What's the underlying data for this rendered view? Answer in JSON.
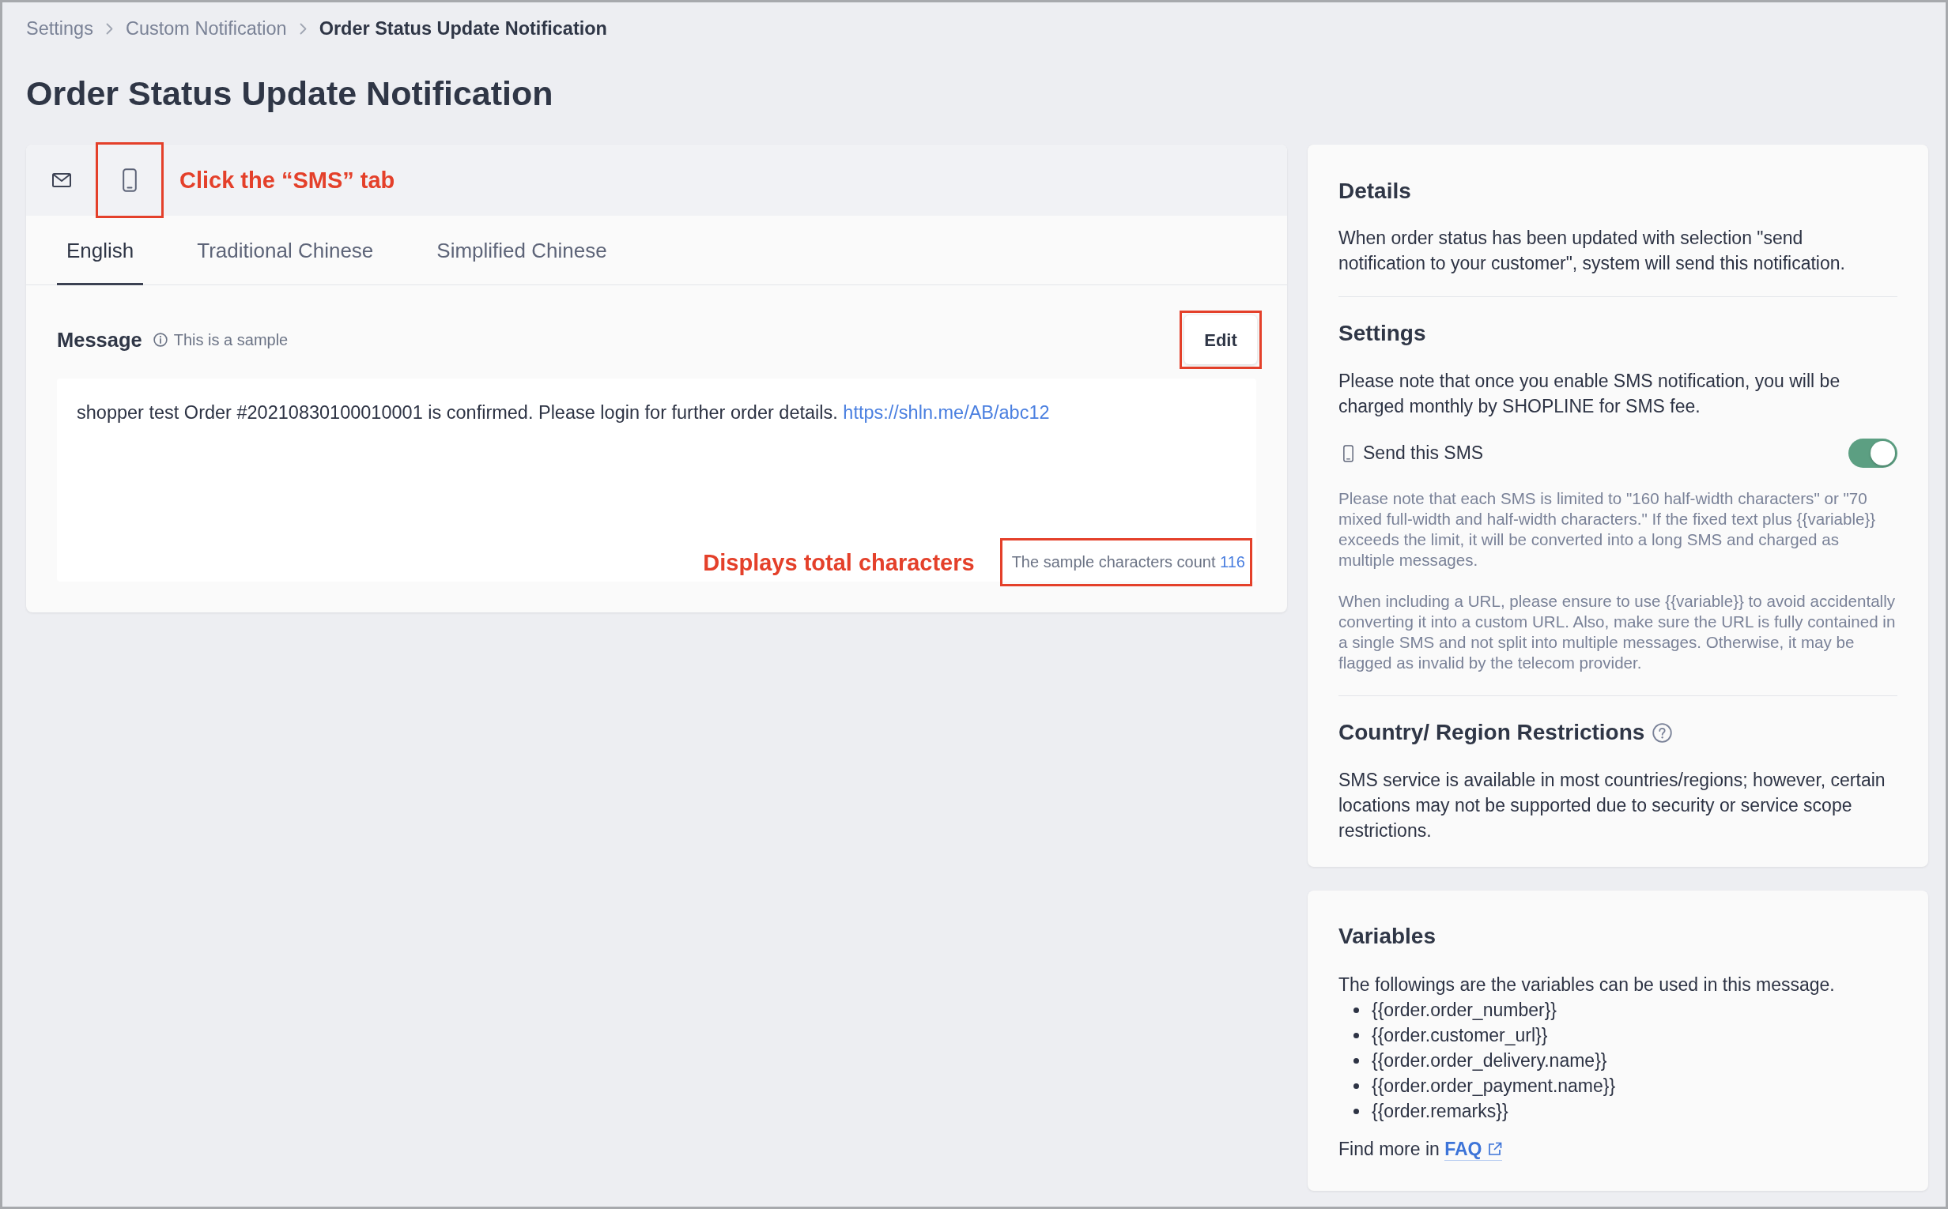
{
  "breadcrumb": [
    {
      "label": "Settings",
      "current": false
    },
    {
      "label": "Custom Notification",
      "current": false
    },
    {
      "label": "Order Status Update Notification",
      "current": true
    }
  ],
  "page_title": "Order Status Update Notification",
  "channel_bar": {
    "tabs": [
      {
        "kind": "email",
        "highlighted": false
      },
      {
        "kind": "sms",
        "highlighted": true
      }
    ],
    "annotation": "Click the “SMS” tab"
  },
  "language_tabs": [
    {
      "label": "English",
      "selected": true
    },
    {
      "label": "Traditional Chinese",
      "selected": false
    },
    {
      "label": "Simplified Chinese",
      "selected": false
    }
  ],
  "message": {
    "label": "Message",
    "hint": "This is a sample",
    "edit_button": {
      "label": "Edit",
      "highlighted": true
    },
    "text": "shopper test Order #20210830100010001 is confirmed. Please login for further order details.",
    "link": "https://shln.me/AB/abc12",
    "count_annotation": "Displays total characters",
    "count": {
      "label": "The sample characters count",
      "value": "116",
      "highlighted": true
    }
  },
  "details": {
    "title": "Details",
    "text": "When order status has been updated with selection \"send notification to your customer\", system will send this notification."
  },
  "settings": {
    "title": "Settings",
    "text": "Please note that once you enable SMS notification, you will be charged monthly by SHOPLINE for SMS fee.",
    "send_sms": {
      "label": "Send this SMS",
      "on": true
    },
    "notes": [
      "Please note that each SMS is limited to \"160 half-width characters\" or \"70 mixed full-width and half-width characters.\" If the fixed text plus {{variable}} exceeds the limit, it will be converted into a long SMS and charged as multiple messages.",
      "When including a URL, please ensure to use {{variable}} to avoid accidentally converting it into a custom URL. Also, make sure the URL is fully contained in a single SMS and not split into multiple messages. Otherwise, it may be flagged as invalid by the telecom provider."
    ]
  },
  "restrictions": {
    "title": "Country/ Region Restrictions",
    "text": "SMS service is available in most countries/regions; however, certain locations may not be supported due to security or service scope restrictions."
  },
  "variables": {
    "title": "Variables",
    "intro": "The followings are the variables can be used in this message.",
    "items": [
      "{{order.order_number}}",
      "{{order.customer_url}}",
      "{{order.order_delivery.name}}",
      "{{order.order_payment.name}}",
      "{{order.remarks}}"
    ],
    "footer": {
      "text": "Find more in",
      "link": "FAQ"
    }
  }
}
